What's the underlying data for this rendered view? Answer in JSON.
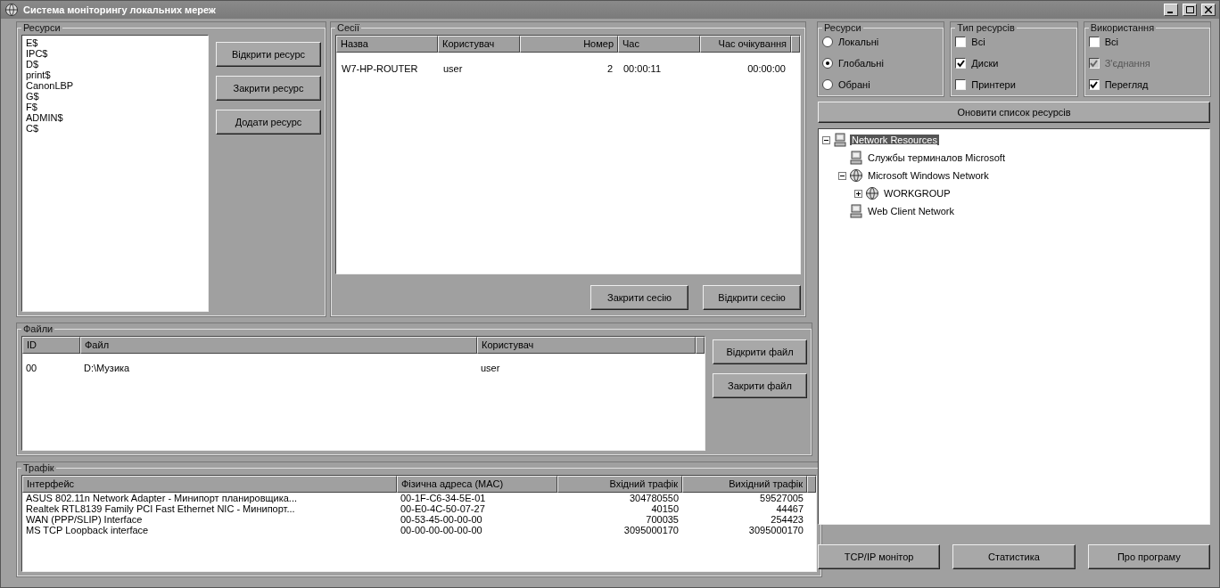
{
  "window": {
    "title": "Система моніторингу локальних мереж"
  },
  "resources": {
    "title": "Ресурси",
    "items": [
      {
        "label": "E$",
        "selected": false
      },
      {
        "label": "IPC$",
        "selected": false
      },
      {
        "label": "D$",
        "selected": false
      },
      {
        "label": "print$",
        "selected": false
      },
      {
        "label": "CanonLBP",
        "selected": false
      },
      {
        "label": "G$",
        "selected": false
      },
      {
        "label": "F$",
        "selected": false
      },
      {
        "label": "ADMIN$",
        "selected": false
      },
      {
        "label": "C$",
        "selected": false
      }
    ],
    "buttons": [
      "Відкрити ресурс",
      "Закрити ресурс",
      "Додати ресурс"
    ]
  },
  "sessions": {
    "title": "Сесії",
    "columns": [
      "Назва",
      "Користувач",
      "Номер",
      "Час",
      "Час очікування"
    ],
    "rows": [
      [
        "W7-HP-ROUTER",
        "user",
        "2",
        "00:00:11",
        "00:00:00"
      ]
    ],
    "buttons": [
      "Закрити сесію",
      "Відкрити сесію"
    ]
  },
  "files": {
    "title": "Файли",
    "columns": [
      "ID",
      "Файл",
      "Користувач"
    ],
    "rows": [
      [
        "00",
        "D:\\Музика",
        "user"
      ]
    ],
    "buttons": [
      "Відкрити файл",
      "Закрити файл"
    ]
  },
  "traffic": {
    "title": "Трафік",
    "columns": [
      "Інтерфейс",
      "Фізична адреса (MAC)",
      "Вхідний трафік",
      "Вихідний трафік"
    ],
    "rows": [
      [
        "ASUS 802.11n Network Adapter - Минипорт планировщика...",
        "00-1F-C6-34-5E-01",
        "304780550",
        "59527005"
      ],
      [
        "Realtek RTL8139 Family PCI Fast Ethernet NIC - Минипорт...",
        "00-E0-4C-50-07-27",
        "40150",
        "44467"
      ],
      [
        "WAN (PPP/SLIP) Interface",
        "00-53-45-00-00-00",
        "700035",
        "254423"
      ],
      [
        "MS TCP Loopback interface",
        "00-00-00-00-00-00",
        "3095000170",
        "3095000170"
      ]
    ]
  },
  "filters": [
    {
      "title": "Ресурси",
      "kind": "radio",
      "options": [
        {
          "label": "Локальні",
          "selected": false,
          "disabled": false
        },
        {
          "label": "Глобальні",
          "selected": true,
          "disabled": false
        },
        {
          "label": "Обрані",
          "selected": false,
          "disabled": false
        }
      ]
    },
    {
      "title": "Тип ресурсів",
      "kind": "check",
      "options": [
        {
          "label": "Всі",
          "selected": false,
          "disabled": false
        },
        {
          "label": "Диски",
          "selected": true,
          "disabled": false
        },
        {
          "label": "Принтери",
          "selected": false,
          "disabled": false
        }
      ]
    },
    {
      "title": "Використання",
      "kind": "check",
      "options": [
        {
          "label": "Всі",
          "selected": false,
          "disabled": false
        },
        {
          "label": "З'єднання",
          "selected": true,
          "disabled": true
        },
        {
          "label": "Перегляд",
          "selected": true,
          "disabled": false
        }
      ]
    }
  ],
  "refresh_button": "Оновити список ресурсів",
  "tree": [
    {
      "label": "Network Resources",
      "kind": "service",
      "selected": true,
      "expanded": true,
      "children": [
        {
          "label": "Службы терминалов Microsoft",
          "kind": "service",
          "selected": false
        },
        {
          "label": "Microsoft Windows Network",
          "kind": "domain",
          "selected": false,
          "expanded": true,
          "children": [
            {
              "label": "WORKGROUP",
              "kind": "domain",
              "selected": false,
              "expanded": false
            }
          ]
        },
        {
          "label": "Web Client Network",
          "kind": "service",
          "selected": false
        }
      ]
    }
  ],
  "bottom_buttons": [
    "TCP/IP монітор",
    "Статистика",
    "Про програму"
  ]
}
